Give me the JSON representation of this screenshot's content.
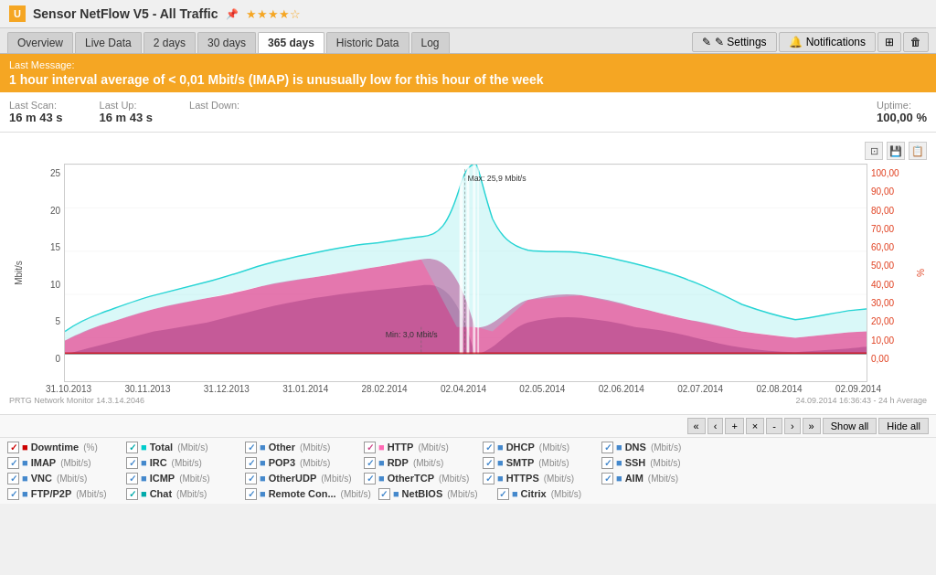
{
  "titleBar": {
    "icon": "U",
    "title": "Sensor NetFlow V5 - All Traffic",
    "stars": "★★★★",
    "halfStar": "☆"
  },
  "tabs": [
    {
      "label": "Overview",
      "active": false
    },
    {
      "label": "Live Data",
      "active": false
    },
    {
      "label": "2 days",
      "active": false
    },
    {
      "label": "30 days",
      "active": false
    },
    {
      "label": "365 days",
      "active": true
    },
    {
      "label": "Historic Data",
      "active": false
    },
    {
      "label": "Log",
      "active": false
    }
  ],
  "toolbarBtns": [
    {
      "label": "✎ Settings"
    },
    {
      "label": "🔔 Notifications"
    },
    {
      "label": "⊞"
    },
    {
      "label": "🗑"
    }
  ],
  "alert": {
    "label": "Last Message:",
    "message": "1 hour interval average of < 0,01 Mbit/s (IMAP) is unusually low for this hour of the week"
  },
  "stats": [
    {
      "label": "Last Scan:",
      "value": "16 m 43 s"
    },
    {
      "label": "Last Up:",
      "value": "16 m 43 s"
    },
    {
      "label": "Last Down:",
      "value": ""
    },
    {
      "label": "Uptime:",
      "value": "100,00 %"
    }
  ],
  "chart": {
    "yAxisLeft": [
      "25",
      "20",
      "15",
      "10",
      "5",
      "0"
    ],
    "yAxisRight": [
      "100,00",
      "90,00",
      "80,00",
      "70,00",
      "60,00",
      "50,00",
      "40,00",
      "30,00",
      "20,00",
      "10,00",
      "0,00"
    ],
    "yLabel": "Mbit/s",
    "xLabels": [
      "31.10.2013",
      "31.10.2013",
      "30.11.2013",
      "31.12.2013",
      "31.01.2014",
      "28.02.2014",
      "02.04.2014",
      "02.05.2014",
      "02.06.2014",
      "02.07.2014",
      "02.08.2014",
      "02.09.2014"
    ],
    "maxAnnotation": "Max: 25,9 Mbit/s",
    "minAnnotation": "Min: 3,0 Mbit/s",
    "footer": {
      "left": "PRTG Network Monitor 14.3.14.2046",
      "right": "24.09.2014 16:36:43 - 24 h Average"
    }
  },
  "navBtns": [
    "«",
    "‹",
    "+",
    "×",
    "-",
    ">",
    "»"
  ],
  "legendControls": {
    "showAll": "Show all",
    "hideAll": "Hide all"
  },
  "legend": [
    [
      {
        "name": "Downtime",
        "unit": "(%)",
        "checked": true,
        "checkColor": "red",
        "color": "#cc0000"
      },
      {
        "name": "Total",
        "unit": "(Mbit/s)",
        "checked": true,
        "checkColor": "teal",
        "color": "#00cccc"
      },
      {
        "name": "Other",
        "unit": "(Mbit/s)",
        "checked": true,
        "checkColor": "blue",
        "color": "#4488cc"
      },
      {
        "name": "HTTP",
        "unit": "(Mbit/s)",
        "checked": true,
        "checkColor": "green",
        "color": "#ff69b4"
      },
      {
        "name": "DHCP",
        "unit": "(Mbit/s)",
        "checked": true,
        "checkColor": "blue",
        "color": "#4488cc"
      },
      {
        "name": "DNS",
        "unit": "(Mbit/s)",
        "checked": true,
        "checkColor": "blue",
        "color": "#4488cc"
      }
    ],
    [
      {
        "name": "IMAP",
        "unit": "(Mbit/s)",
        "checked": true,
        "checkColor": "blue",
        "color": "#4488cc"
      },
      {
        "name": "IRC",
        "unit": "(Mbit/s)",
        "checked": true,
        "checkColor": "blue",
        "color": "#4488cc"
      },
      {
        "name": "POP3",
        "unit": "(Mbit/s)",
        "checked": true,
        "checkColor": "blue",
        "color": "#4488cc"
      },
      {
        "name": "RDP",
        "unit": "(Mbit/s)",
        "checked": true,
        "checkColor": "blue",
        "color": "#4488cc"
      },
      {
        "name": "SMTP",
        "unit": "(Mbit/s)",
        "checked": true,
        "checkColor": "blue",
        "color": "#4488cc"
      },
      {
        "name": "SSH",
        "unit": "(Mbit/s)",
        "checked": true,
        "checkColor": "blue",
        "color": "#4488cc"
      }
    ],
    [
      {
        "name": "VNC",
        "unit": "(Mbit/s)",
        "checked": true,
        "checkColor": "blue",
        "color": "#4488cc"
      },
      {
        "name": "ICMP",
        "unit": "(Mbit/s)",
        "checked": true,
        "checkColor": "blue",
        "color": "#4488cc"
      },
      {
        "name": "OtherUDP",
        "unit": "(Mbit/s)",
        "checked": true,
        "checkColor": "blue",
        "color": "#4488cc"
      },
      {
        "name": "OtherTCP",
        "unit": "(Mbit/s)",
        "checked": true,
        "checkColor": "blue",
        "color": "#4488cc"
      },
      {
        "name": "HTTPS",
        "unit": "(Mbit/s)",
        "checked": true,
        "checkColor": "blue",
        "color": "#4488cc"
      },
      {
        "name": "AIM",
        "unit": "(Mbit/s)",
        "checked": true,
        "checkColor": "blue",
        "color": "#4488cc"
      }
    ],
    [
      {
        "name": "FTP/P2P",
        "unit": "(Mbit/s)",
        "checked": true,
        "checkColor": "blue",
        "color": "#4488cc"
      },
      {
        "name": "Chat",
        "unit": "(Mbit/s)",
        "checked": true,
        "checkColor": "teal",
        "color": "#00aaaa"
      },
      {
        "name": "Remote Con...",
        "unit": "(Mbit/s)",
        "checked": true,
        "checkColor": "blue",
        "color": "#4488cc"
      },
      {
        "name": "NetBIOS",
        "unit": "(Mbit/s)",
        "checked": true,
        "checkColor": "blue",
        "color": "#4488cc"
      },
      {
        "name": "Citrix",
        "unit": "(Mbit/s)",
        "checked": true,
        "checkColor": "blue",
        "color": "#4488cc"
      },
      {
        "name": "",
        "unit": "",
        "checked": false,
        "checkColor": "",
        "color": ""
      }
    ]
  ]
}
